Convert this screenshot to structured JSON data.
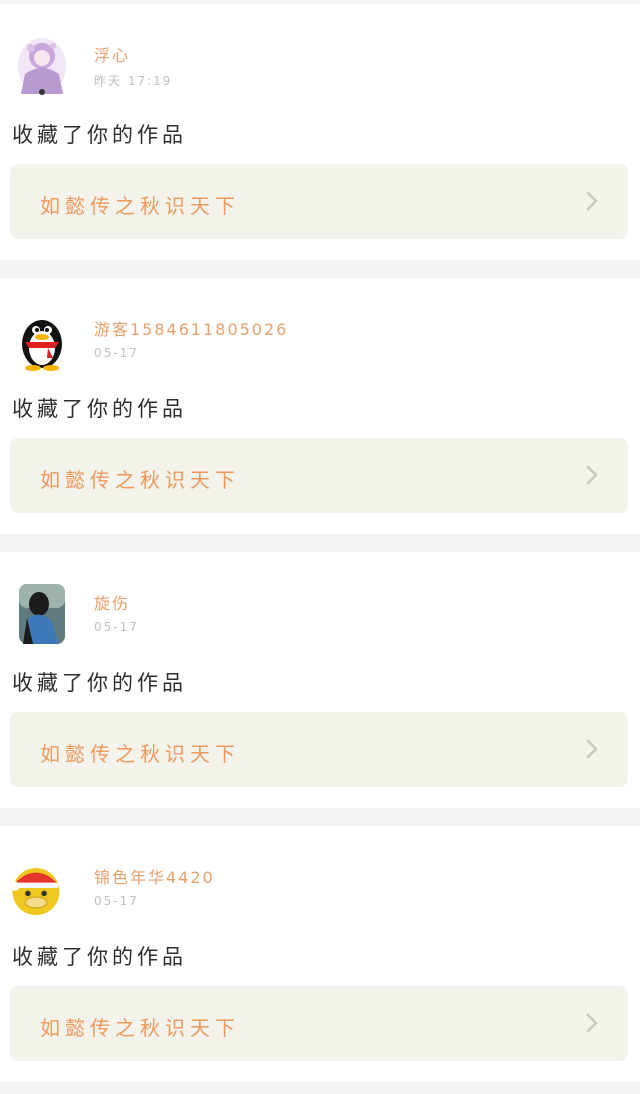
{
  "notifications": [
    {
      "avatar_icon": "anime-girl-avatar-icon",
      "username": "浮心",
      "time": "昨天 17:19",
      "action": "收藏了你的作品",
      "work_title": "如懿传之秋识天下"
    },
    {
      "avatar_icon": "qq-penguin-avatar-icon",
      "username": "游客1584611805026",
      "time": "05-17",
      "action": "收藏了你的作品",
      "work_title": "如懿传之秋识天下"
    },
    {
      "avatar_icon": "photo-avatar-icon",
      "username": "旋伤",
      "time": "05-17",
      "action": "收藏了你的作品",
      "work_title": "如懿传之秋识天下"
    },
    {
      "avatar_icon": "cartoon-duck-avatar-icon",
      "username": "锦色年华4420",
      "time": "05-17",
      "action": "收藏了你的作品",
      "work_title": "如懿传之秋识天下"
    }
  ],
  "colors": {
    "background": "#f7f4f4",
    "card": "#ffffff",
    "username": "#e9a06c",
    "work_title": "#ec9a5d",
    "link_background": "#f3f3ec",
    "chevron": "#c9c9c4"
  }
}
